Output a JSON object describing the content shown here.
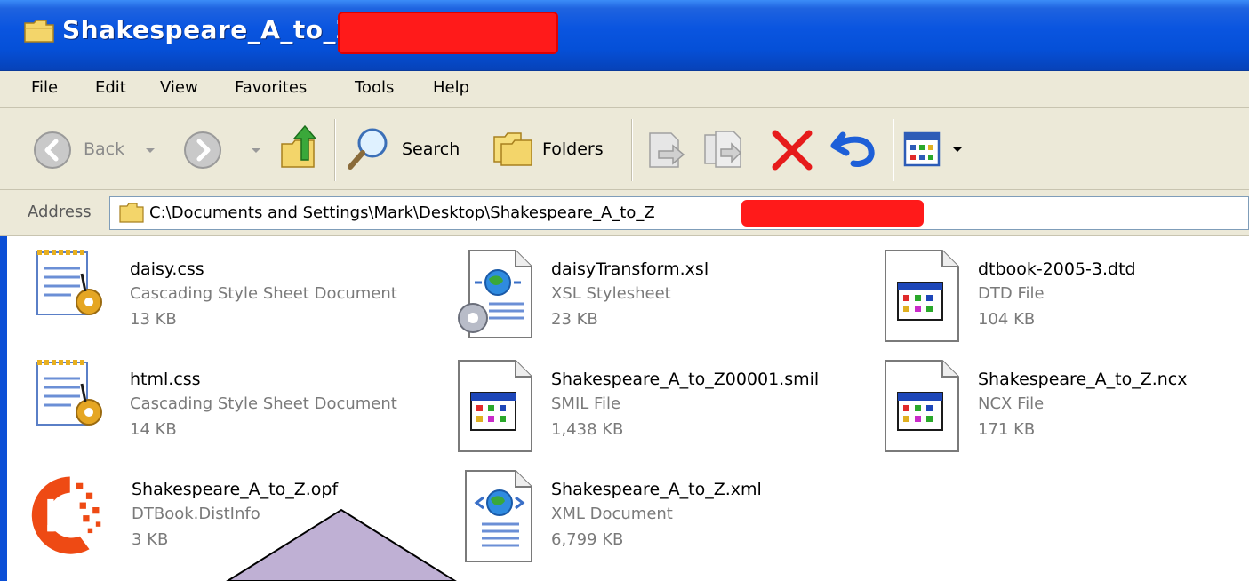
{
  "window": {
    "title": "Shakespeare_A_to_Z_"
  },
  "menu": {
    "items": [
      "File",
      "Edit",
      "View",
      "Favorites",
      "Tools",
      "Help"
    ]
  },
  "toolbar": {
    "back_label": "Back",
    "search_label": "Search",
    "folders_label": "Folders"
  },
  "address": {
    "label": "Address",
    "path": "C:\\Documents and Settings\\Mark\\Desktop\\Shakespeare_A_to_Z"
  },
  "files": [
    {
      "name": "daisy.css",
      "type": "Cascading Style Sheet Document",
      "size": "13 KB",
      "icon": "css-gear-icon"
    },
    {
      "name": "daisyTransform.xsl",
      "type": "XSL Stylesheet",
      "size": "23 KB",
      "icon": "xsl-gear-icon"
    },
    {
      "name": "dtbook-2005-3.dtd",
      "type": "DTD File",
      "size": "104 KB",
      "icon": "generic-window-file-icon"
    },
    {
      "name": "html.css",
      "type": "Cascading Style Sheet Document",
      "size": "14 KB",
      "icon": "css-gear-icon"
    },
    {
      "name": "Shakespeare_A_to_Z00001.smil",
      "type": "SMIL File",
      "size": "1,438 KB",
      "icon": "generic-window-file-icon"
    },
    {
      "name": "Shakespeare_A_to_Z.ncx",
      "type": "NCX File",
      "size": "171 KB",
      "icon": "generic-window-file-icon"
    },
    {
      "name": "Shakespeare_A_to_Z.opf",
      "type": "DTBook.DistInfo",
      "size": "3 KB",
      "icon": "dtbook-logo-icon"
    },
    {
      "name": "Shakespeare_A_to_Z.xml",
      "type": "XML Document",
      "size": "6,799 KB",
      "icon": "xml-document-icon"
    }
  ],
  "colors": {
    "titlebar": "#0550d8",
    "chrome": "#ece9d8",
    "redaction": "#ff1a1a",
    "callout_fill": "#bfb0d4"
  }
}
